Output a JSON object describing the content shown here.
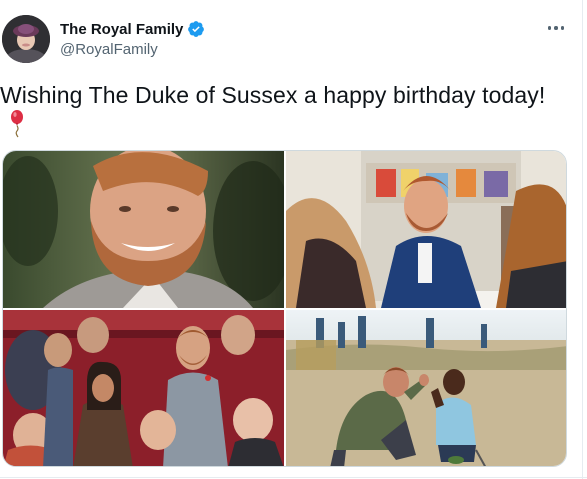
{
  "tweet": {
    "display_name": "The Royal Family",
    "handle": "@RoyalFamily",
    "text": "Wishing The Duke of Sussex a happy birthday today!",
    "emoji_icon": "balloon-icon",
    "verified": true
  },
  "media": {
    "photos": [
      {
        "subject": "portrait-smiling"
      },
      {
        "subject": "seated-at-table"
      },
      {
        "subject": "crowd-stands"
      },
      {
        "subject": "high-five-field"
      }
    ]
  },
  "colors": {
    "verified_blue": "#1d9bf0",
    "text_primary": "#0f1419",
    "text_secondary": "#536471",
    "border": "#cfd9de"
  }
}
